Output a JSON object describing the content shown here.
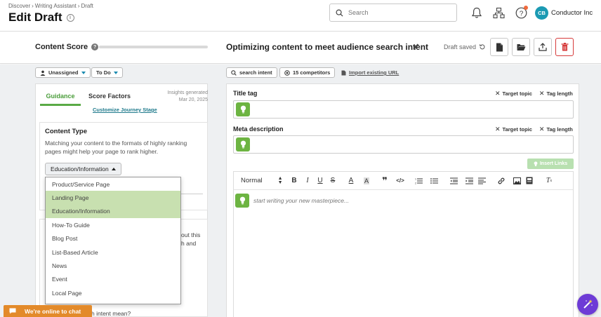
{
  "breadcrumb": {
    "items": [
      "Discover",
      "Writing Assistant",
      "Draft"
    ]
  },
  "page": {
    "title": "Edit Draft"
  },
  "search": {
    "placeholder": "Search"
  },
  "account": {
    "initials": "CB",
    "org": "Conductor Inc"
  },
  "score_bar": {
    "label": "Content Score",
    "doc_title": "Optimizing content to meet audience search intent",
    "status": "Draft saved"
  },
  "filters": {
    "assignee": "Unassigned",
    "status": "To Do",
    "search_intent": "search intent",
    "competitors": "15 competitors",
    "import_url": "Import existing URL"
  },
  "left": {
    "tabs": [
      "Guidance",
      "Score Factors"
    ],
    "customize": "Customize Journey Stage",
    "insights_line1": "Insights generated",
    "insights_line2": "Mar 20, 2025",
    "content_type": {
      "heading": "Content Type",
      "description": "Matching your content to the formats of highly ranking pages might help your page to rank higher.",
      "selected": "Education/Information",
      "options": [
        "Product/Service Page",
        "Landing Page",
        "Education/Information",
        "How-To Guide",
        "Blog Post",
        "List-Based Article",
        "News",
        "Event",
        "Local Page"
      ]
    },
    "fragments": {
      "f1": "out this",
      "f2": "h and",
      "f3": "h intent mean?"
    }
  },
  "right": {
    "title_tag_label": "Title tag",
    "meta_label": "Meta description",
    "target_topic": "Target topic",
    "tag_length": "Tag length",
    "insert_links": "Insert Links",
    "format_select": "Normal",
    "editor_placeholder": "start writing your new masterpiece..."
  },
  "chat": {
    "label": "We're online to chat"
  },
  "colors": {
    "accent_green": "#5aaa46",
    "teal": "#1b9ab3",
    "chat_orange": "#e38a2a",
    "danger": "#d63a3a",
    "wand_purple": "#6d3bd6"
  }
}
